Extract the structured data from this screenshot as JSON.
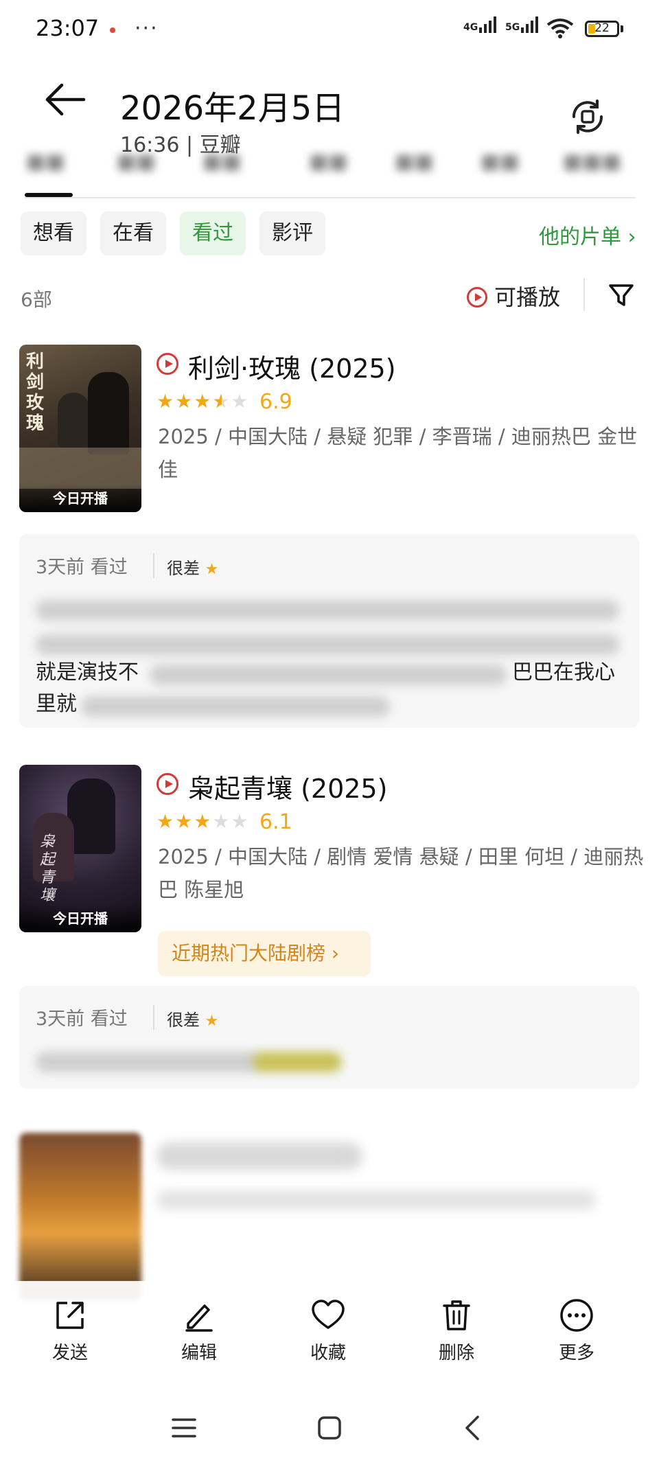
{
  "status_bar": {
    "time": "23:07",
    "more": "···",
    "net1": "4G",
    "net2": "5G",
    "battery": "22"
  },
  "header": {
    "title": "2026年2月5日",
    "subtitle": "16:36 | 豆瓣"
  },
  "filters": {
    "chips": [
      "想看",
      "在看",
      "看过",
      "影评"
    ],
    "active": "看过",
    "his_list": "他的片单 ›"
  },
  "list": {
    "count": "6部",
    "playable": "可播放"
  },
  "movies": [
    {
      "title": "利剑·玫瑰 (2025)",
      "rating": 3.5,
      "score": "6.9",
      "meta": "2025 / 中国大陆 / 悬疑 犯罪 / 李晋瑞 / 迪丽热巴 金世佳",
      "poster_badge": "今日开播",
      "poster_text": "利剑玫瑰",
      "review": {
        "date": "3天前 看过",
        "rating_label": "很差",
        "line3_a": "就是演技不",
        "line3_b": "巴巴在我心",
        "line4_a": "里就"
      }
    },
    {
      "title": "枭起青壤 (2025)",
      "rating": 3,
      "score": "6.1",
      "meta": "2025 / 中国大陆 / 剧情 爱情 悬疑 / 田里 何坦 / 迪丽热巴 陈星旭",
      "poster_badge": "今日开播",
      "poster_text": "枭起青壤",
      "rank_tag": "近期热门大陆剧榜 ›",
      "review": {
        "date": "3天前 看过",
        "rating_label": "很差"
      }
    }
  ],
  "actions": [
    {
      "label": "发送",
      "icon": "share-icon"
    },
    {
      "label": "编辑",
      "icon": "edit-icon"
    },
    {
      "label": "收藏",
      "icon": "heart-icon"
    },
    {
      "label": "删除",
      "icon": "trash-icon"
    },
    {
      "label": "更多",
      "icon": "more-icon"
    }
  ],
  "colors": {
    "green": "#2e9a3c",
    "star": "#f4a716",
    "red": "#d23a3a",
    "rank": "#d3851a"
  }
}
